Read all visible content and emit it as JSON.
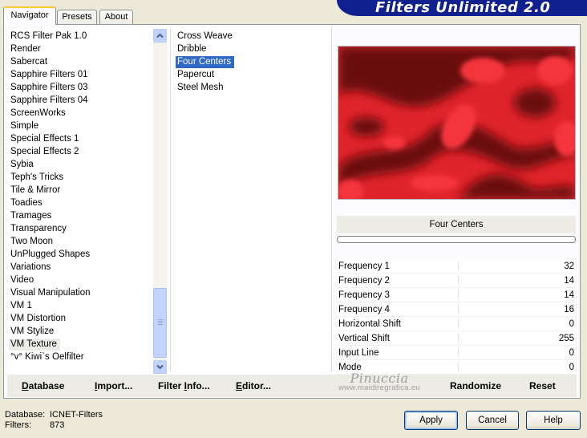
{
  "tabs": [
    {
      "label": "Navigator",
      "active": true
    },
    {
      "label": "Presets",
      "active": false
    },
    {
      "label": "About",
      "active": false
    }
  ],
  "banner": {
    "title": "Filters Unlimited 2.0",
    "color": "#10208e"
  },
  "categories": {
    "items": [
      "RCS Filter Pak 1.0",
      "Render",
      "Sabercat",
      "Sapphire Filters 01",
      "Sapphire Filters 03",
      "Sapphire Filters 04",
      "ScreenWorks",
      "Simple",
      "Special Effects 1",
      "Special Effects 2",
      "Sybia",
      "Teph's Tricks",
      "Tile & Mirror",
      "Toadies",
      "Tramages",
      "Transparency",
      "Two Moon",
      "UnPlugged Shapes",
      "Variations",
      "Video",
      "Visual Manipulation",
      "VM 1",
      "VM Distortion",
      "VM Stylize",
      "VM Texture",
      "°v° Kiwi`s Oelfilter"
    ],
    "selected_index": 24
  },
  "filters": {
    "items": [
      "Cross Weave",
      "Dribble",
      "Four Centers",
      "Papercut",
      "Steel Mesh"
    ],
    "selected_index": 2,
    "selection_color": "#316ac5"
  },
  "preview": {
    "filter_name": "Four Centers",
    "colors": {
      "light": "#f4343e",
      "dark": "#6a0a10",
      "base": "#e0242c"
    }
  },
  "parameters": [
    {
      "name": "Frequency 1",
      "value": "32"
    },
    {
      "name": "Frequency 2",
      "value": "14"
    },
    {
      "name": "Frequency 3",
      "value": "14"
    },
    {
      "name": "Frequency 4",
      "value": "16"
    },
    {
      "name": "Horizontal Shift",
      "value": "0"
    },
    {
      "name": "Vertical Shift",
      "value": "255"
    },
    {
      "name": "Input Line",
      "value": "0"
    },
    {
      "name": "Mode",
      "value": "0"
    }
  ],
  "bottom_buttons": {
    "database": {
      "label": "Database",
      "accel": "D",
      "rest": "atabase"
    },
    "import": {
      "label": "Import...",
      "accel": "I",
      "rest": "mport..."
    },
    "filter_info": {
      "label": "Filter Info...",
      "pre": "Filter ",
      "accel": "I",
      "rest": "nfo..."
    },
    "editor": {
      "label": "Editor...",
      "accel": "E",
      "rest": "ditor..."
    },
    "randomize": {
      "label": "Randomize"
    },
    "reset": {
      "label": "Reset"
    }
  },
  "watermark": {
    "name": "Pinuccia",
    "url": "www.maidiregrafica.eu"
  },
  "status": {
    "database_label": "Database:",
    "database_value": "ICNET-Filters",
    "filters_label": "Filters:",
    "filters_value": "873"
  },
  "dialog_buttons": {
    "apply": "Apply",
    "cancel": "Cancel",
    "help": "Help"
  }
}
